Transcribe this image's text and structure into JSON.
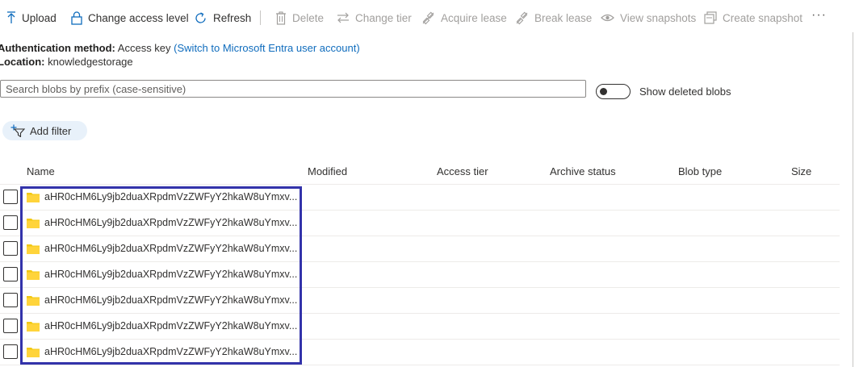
{
  "toolbar": {
    "upload": "Upload",
    "change_access_level": "Change access level",
    "refresh": "Refresh",
    "delete": "Delete",
    "change_tier": "Change tier",
    "acquire_lease": "Acquire lease",
    "break_lease": "Break lease",
    "view_snapshots": "View snapshots",
    "create_snapshot": "Create snapshot",
    "more": "···"
  },
  "info": {
    "auth_label": "Authentication method:",
    "auth_value": "Access key",
    "auth_link": "(Switch to Microsoft Entra user account)",
    "location_label": "Location:",
    "location_value": "knowledgestorage"
  },
  "search": {
    "placeholder": "Search blobs by prefix (case-sensitive)",
    "value": ""
  },
  "toggle": {
    "label": "Show deleted blobs",
    "on": false
  },
  "filter": {
    "label": "Add filter"
  },
  "table": {
    "columns": [
      "Name",
      "Modified",
      "Access tier",
      "Archive status",
      "Blob type",
      "Size"
    ],
    "rows": [
      {
        "name": "aHR0cHM6Ly9jb2duaXRpdmVzZWFyY2hkaW8uYmxv..."
      },
      {
        "name": "aHR0cHM6Ly9jb2duaXRpdmVzZWFyY2hkaW8uYmxv..."
      },
      {
        "name": "aHR0cHM6Ly9jb2duaXRpdmVzZWFyY2hkaW8uYmxv..."
      },
      {
        "name": "aHR0cHM6Ly9jb2duaXRpdmVzZWFyY2hkaW8uYmxv..."
      },
      {
        "name": "aHR0cHM6Ly9jb2duaXRpdmVzZWFyY2hkaW8uYmxv..."
      },
      {
        "name": "aHR0cHM6Ly9jb2duaXRpdmVzZWFyY2hkaW8uYmxv..."
      },
      {
        "name": "aHR0cHM6Ly9jb2duaXRpdmVzZWFyY2hkaW8uYmxv..."
      }
    ]
  },
  "colors": {
    "accent": "#0f6cbd",
    "folder": "#f2c811",
    "highlight": "#3333aa",
    "disabled": "#a19f9d"
  }
}
